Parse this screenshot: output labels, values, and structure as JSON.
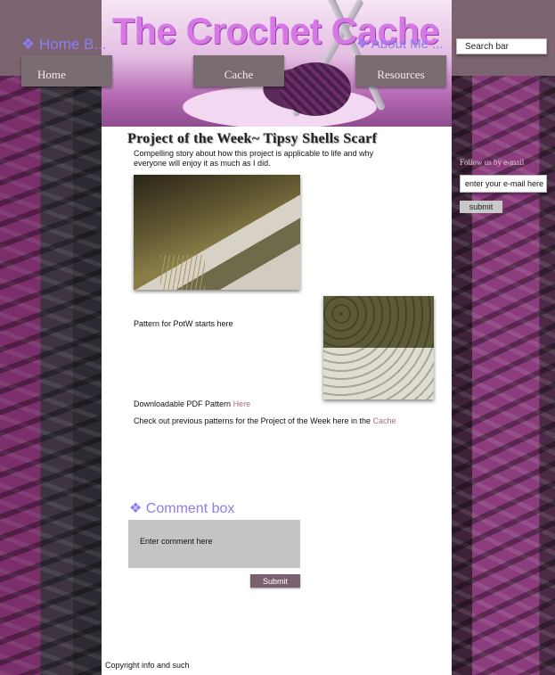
{
  "header": {
    "site_title": "The Crochet Cache",
    "ghost_home": "❖ Home B...",
    "ghost_about": "❖ About Me ...",
    "search_placeholder": "Search bar"
  },
  "nav": {
    "home": "Home",
    "cache": "Cache",
    "resources": "Resources"
  },
  "main": {
    "potw_title": "Project of the Week~ Tipsy Shells Scarf",
    "story": "Compelling story about how this project is applicable to life and why everyone will enjoy it as much as I did.",
    "pattern_start": "Pattern for PotW starts here",
    "pdf_prefix": "Downloadable PDF Pattern ",
    "pdf_link": "Here",
    "prev_prefix": "Check out previous patterns for the Project of the Week here in the ",
    "prev_link": "Cache"
  },
  "comments": {
    "heading": "❖ Comment box",
    "placeholder": "Enter comment here",
    "submit_label": "Submit"
  },
  "sidebar": {
    "follow_label": "Follow us by e-mail",
    "email_placeholder": "enter your e-mail here",
    "submit_label": "submit"
  },
  "footer": {
    "copyright": "Copyright info and such"
  },
  "colors": {
    "accent": "#8e7cf0",
    "title": "#d679e6",
    "nav_bg": "#7a6d72",
    "link": "#a56b8a"
  }
}
